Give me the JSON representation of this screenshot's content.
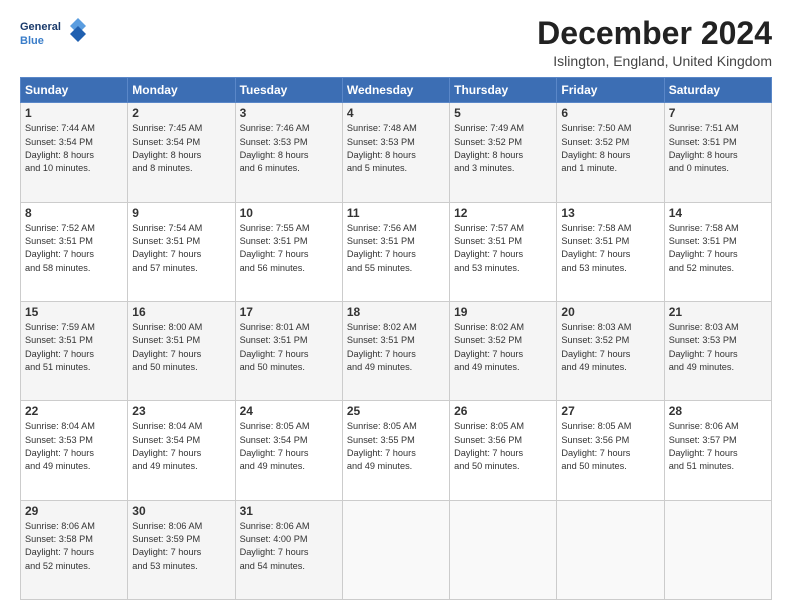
{
  "logo": {
    "line1": "General",
    "line2": "Blue"
  },
  "title": "December 2024",
  "subtitle": "Islington, England, United Kingdom",
  "days_of_week": [
    "Sunday",
    "Monday",
    "Tuesday",
    "Wednesday",
    "Thursday",
    "Friday",
    "Saturday"
  ],
  "weeks": [
    [
      {
        "day": "1",
        "info": "Sunrise: 7:44 AM\nSunset: 3:54 PM\nDaylight: 8 hours\nand 10 minutes."
      },
      {
        "day": "2",
        "info": "Sunrise: 7:45 AM\nSunset: 3:54 PM\nDaylight: 8 hours\nand 8 minutes."
      },
      {
        "day": "3",
        "info": "Sunrise: 7:46 AM\nSunset: 3:53 PM\nDaylight: 8 hours\nand 6 minutes."
      },
      {
        "day": "4",
        "info": "Sunrise: 7:48 AM\nSunset: 3:53 PM\nDaylight: 8 hours\nand 5 minutes."
      },
      {
        "day": "5",
        "info": "Sunrise: 7:49 AM\nSunset: 3:52 PM\nDaylight: 8 hours\nand 3 minutes."
      },
      {
        "day": "6",
        "info": "Sunrise: 7:50 AM\nSunset: 3:52 PM\nDaylight: 8 hours\nand 1 minute."
      },
      {
        "day": "7",
        "info": "Sunrise: 7:51 AM\nSunset: 3:51 PM\nDaylight: 8 hours\nand 0 minutes."
      }
    ],
    [
      {
        "day": "8",
        "info": "Sunrise: 7:52 AM\nSunset: 3:51 PM\nDaylight: 7 hours\nand 58 minutes."
      },
      {
        "day": "9",
        "info": "Sunrise: 7:54 AM\nSunset: 3:51 PM\nDaylight: 7 hours\nand 57 minutes."
      },
      {
        "day": "10",
        "info": "Sunrise: 7:55 AM\nSunset: 3:51 PM\nDaylight: 7 hours\nand 56 minutes."
      },
      {
        "day": "11",
        "info": "Sunrise: 7:56 AM\nSunset: 3:51 PM\nDaylight: 7 hours\nand 55 minutes."
      },
      {
        "day": "12",
        "info": "Sunrise: 7:57 AM\nSunset: 3:51 PM\nDaylight: 7 hours\nand 53 minutes."
      },
      {
        "day": "13",
        "info": "Sunrise: 7:58 AM\nSunset: 3:51 PM\nDaylight: 7 hours\nand 53 minutes."
      },
      {
        "day": "14",
        "info": "Sunrise: 7:58 AM\nSunset: 3:51 PM\nDaylight: 7 hours\nand 52 minutes."
      }
    ],
    [
      {
        "day": "15",
        "info": "Sunrise: 7:59 AM\nSunset: 3:51 PM\nDaylight: 7 hours\nand 51 minutes."
      },
      {
        "day": "16",
        "info": "Sunrise: 8:00 AM\nSunset: 3:51 PM\nDaylight: 7 hours\nand 50 minutes."
      },
      {
        "day": "17",
        "info": "Sunrise: 8:01 AM\nSunset: 3:51 PM\nDaylight: 7 hours\nand 50 minutes."
      },
      {
        "day": "18",
        "info": "Sunrise: 8:02 AM\nSunset: 3:51 PM\nDaylight: 7 hours\nand 49 minutes."
      },
      {
        "day": "19",
        "info": "Sunrise: 8:02 AM\nSunset: 3:52 PM\nDaylight: 7 hours\nand 49 minutes."
      },
      {
        "day": "20",
        "info": "Sunrise: 8:03 AM\nSunset: 3:52 PM\nDaylight: 7 hours\nand 49 minutes."
      },
      {
        "day": "21",
        "info": "Sunrise: 8:03 AM\nSunset: 3:53 PM\nDaylight: 7 hours\nand 49 minutes."
      }
    ],
    [
      {
        "day": "22",
        "info": "Sunrise: 8:04 AM\nSunset: 3:53 PM\nDaylight: 7 hours\nand 49 minutes."
      },
      {
        "day": "23",
        "info": "Sunrise: 8:04 AM\nSunset: 3:54 PM\nDaylight: 7 hours\nand 49 minutes."
      },
      {
        "day": "24",
        "info": "Sunrise: 8:05 AM\nSunset: 3:54 PM\nDaylight: 7 hours\nand 49 minutes."
      },
      {
        "day": "25",
        "info": "Sunrise: 8:05 AM\nSunset: 3:55 PM\nDaylight: 7 hours\nand 49 minutes."
      },
      {
        "day": "26",
        "info": "Sunrise: 8:05 AM\nSunset: 3:56 PM\nDaylight: 7 hours\nand 50 minutes."
      },
      {
        "day": "27",
        "info": "Sunrise: 8:05 AM\nSunset: 3:56 PM\nDaylight: 7 hours\nand 50 minutes."
      },
      {
        "day": "28",
        "info": "Sunrise: 8:06 AM\nSunset: 3:57 PM\nDaylight: 7 hours\nand 51 minutes."
      }
    ],
    [
      {
        "day": "29",
        "info": "Sunrise: 8:06 AM\nSunset: 3:58 PM\nDaylight: 7 hours\nand 52 minutes."
      },
      {
        "day": "30",
        "info": "Sunrise: 8:06 AM\nSunset: 3:59 PM\nDaylight: 7 hours\nand 53 minutes."
      },
      {
        "day": "31",
        "info": "Sunrise: 8:06 AM\nSunset: 4:00 PM\nDaylight: 7 hours\nand 54 minutes."
      },
      {
        "day": "",
        "info": ""
      },
      {
        "day": "",
        "info": ""
      },
      {
        "day": "",
        "info": ""
      },
      {
        "day": "",
        "info": ""
      }
    ]
  ]
}
